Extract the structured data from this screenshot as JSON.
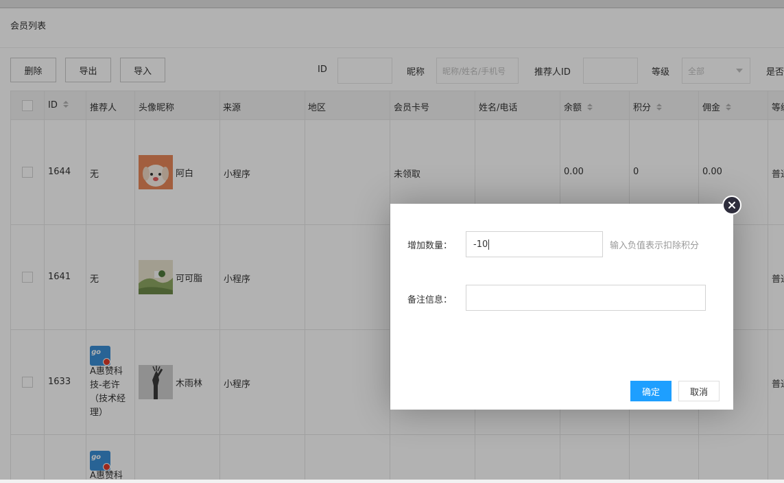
{
  "card": {
    "title": "会员列表"
  },
  "toolbar": {
    "delete": "删除",
    "export": "导出",
    "import": "导入"
  },
  "filters": {
    "id_label": "ID",
    "id_value": "",
    "nickname_label": "昵称",
    "nickname_placeholder": "昵称/姓名/手机号",
    "referrer_label": "推荐人ID",
    "referrer_value": "",
    "level_label": "等级",
    "level_value": "全部",
    "cut_label": "是否"
  },
  "table": {
    "headers": [
      "ID",
      "推荐人",
      "头像昵称",
      "来源",
      "地区",
      "会员卡号",
      "姓名/电话",
      "余额",
      "积分",
      "佣金",
      "等级"
    ],
    "rows": [
      {
        "id": "1644",
        "referrer": "无",
        "nickname": "阿白",
        "source": "小程序",
        "region": "",
        "card_no": "未领取",
        "name_phone": "",
        "balance": "0.00",
        "points": "0",
        "commission": "0.00",
        "level": "普通会员"
      },
      {
        "id": "1641",
        "referrer": "无",
        "nickname": "可可脂",
        "source": "小程序",
        "level": "普通会员"
      },
      {
        "id": "1633",
        "referrer": "A惠赞科技-老许（技术经理）",
        "nickname": "木雨林",
        "source": "小程序",
        "level": "普通会员"
      },
      {
        "referrer_partial": "A惠赞科"
      }
    ]
  },
  "dialog": {
    "qty_label": "增加数量：",
    "qty_value": "-10",
    "qty_hint": "输入负值表示扣除积分",
    "remark_label": "备注信息：",
    "remark_value": "",
    "ok": "确定",
    "cancel": "取消"
  },
  "icons": {
    "close": "close-icon",
    "sort": "sort-icon",
    "referrer_logo": "referrer-logo-icon"
  },
  "colors": {
    "primary": "#1e9fff",
    "close_bg": "#2e2d3c",
    "overlay": "rgba(0,0,0,0.3)"
  }
}
